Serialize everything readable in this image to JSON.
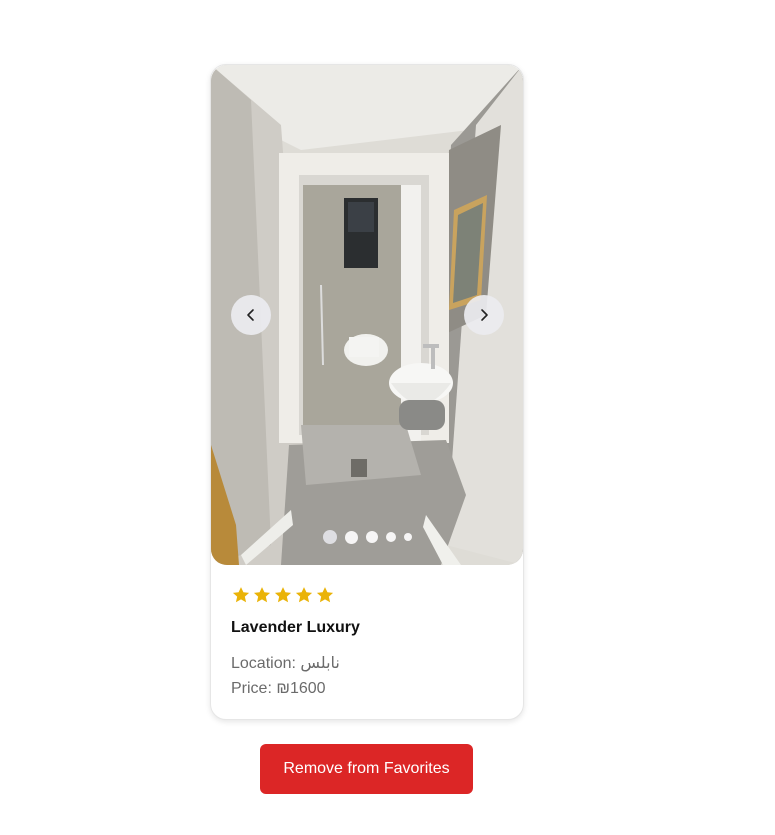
{
  "listing": {
    "rating": 5,
    "rating_color": "#eab308",
    "title": "Lavender Luxury",
    "location_label": "Location:",
    "location_value": "نابلس",
    "price_label": "Price:",
    "price_value": "₪1600",
    "image_count": 5,
    "active_image_index": 0,
    "image_subject": "bathroom"
  },
  "actions": {
    "remove_label": "Remove from Favorites",
    "remove_color": "#dc2626"
  },
  "icons": {
    "prev": "chevron-left-icon",
    "next": "chevron-right-icon",
    "star": "star-icon"
  }
}
